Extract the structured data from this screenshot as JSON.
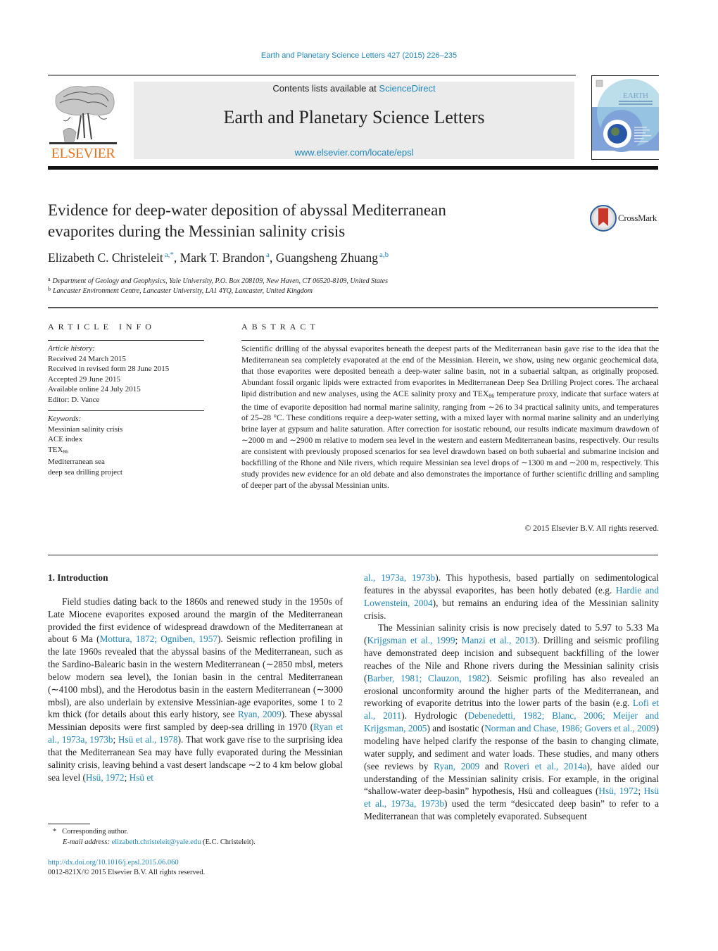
{
  "header": {
    "citation": "Earth and Planetary Science Letters 427 (2015) 226–235",
    "contents_prefix": "Contents lists available at ",
    "contents_link": "ScienceDirect",
    "journal_title": "Earth and Planetary Science Letters",
    "journal_url": "www.elsevier.com/locate/epsl",
    "publisher_logo_text": "ELSEVIER",
    "cover_title": "EARTH",
    "cover_subtitle": "& PLANETARY SCIENCE LETTERS"
  },
  "article": {
    "title_line1": "Evidence for deep-water deposition of abyssal Mediterranean",
    "title_line2": "evaporites during the Messinian salinity crisis",
    "crossmark_label": "CrossMark",
    "authors": [
      {
        "name": "Elizabeth C. Christeleit",
        "sup": "a,*",
        "sep": ", "
      },
      {
        "name": "Mark T. Brandon",
        "sup": "a",
        "sep": ", "
      },
      {
        "name": "Guangsheng Zhuang",
        "sup": "a,b",
        "sep": ""
      }
    ],
    "affiliations": [
      {
        "key": "a",
        "text": "Department of Geology and Geophysics, Yale University, P.O. Box 208109, New Haven, CT 06520-8109, United States"
      },
      {
        "key": "b",
        "text": "Lancaster Environment Centre, Lancaster University, LA1 4YQ, Lancaster, United Kingdom"
      }
    ]
  },
  "article_info": {
    "heading": "ARTICLE INFO",
    "history_label": "Article history:",
    "history": [
      "Received 24 March 2015",
      "Received in revised form 28 June 2015",
      "Accepted 29 June 2015",
      "Available online 24 July 2015",
      "Editor: D. Vance"
    ],
    "keywords_label": "Keywords:",
    "keywords": [
      {
        "text": "Messinian salinity crisis",
        "sub": ""
      },
      {
        "text": "ACE index",
        "sub": ""
      },
      {
        "text": "TEX",
        "sub": "86"
      },
      {
        "text": "Mediterranean sea",
        "sub": ""
      },
      {
        "text": "deep sea drilling project",
        "sub": ""
      }
    ]
  },
  "abstract": {
    "heading": "ABSTRACT",
    "text_part1": "Scientific drilling of the abyssal evaporites beneath the deepest parts of the Mediterranean basin gave rise to the idea that the Mediterranean sea completely evaporated at the end of the Messinian. Herein, we show, using new organic geochemical data, that those evaporites were deposited beneath a deep-water saline basin, not in a subaerial saltpan, as originally proposed. Abundant fossil organic lipids were extracted from evaporites in Mediterranean Deep Sea Drilling Project cores. The archaeal lipid distribution and new analyses, using the ACE salinity proxy and TEX",
    "text_sub": "86",
    "text_part2": " temperature proxy, indicate that surface waters at the time of evaporite deposition had normal marine salinity, ranging from ∼26 to 34 practical salinity units, and temperatures of 25–28 °C. These conditions require a deep-water setting, with a mixed layer with normal marine salinity and an underlying brine layer at gypsum and halite saturation. After correction for isostatic rebound, our results indicate maximum drawdown of ∼2000 m and ∼2900 m relative to modern sea level in the western and eastern Mediterranean basins, respectively. Our results are consistent with previously proposed scenarios for sea level drawdown based on both subaerial and submarine incision and backfilling of the Rhone and Nile rivers, which require Messinian sea level drops of ∼1300 m and ∼200 m, respectively. This study provides new evidence for an old debate and also demonstrates the importance of further scientific drilling and sampling of deeper part of the abyssal Messinian units.",
    "copyright": "© 2015 Elsevier B.V. All rights reserved."
  },
  "body": {
    "section_heading": "1. Introduction",
    "left_column": [
      {
        "t": "Field studies dating back to the 1860s and renewed study in the 1950s of Late Miocene evaporites exposed around the margin of the Mediterranean provided the first evidence of widespread drawdown of the Mediterranean at about 6 Ma (",
        "link": false
      },
      {
        "t": "Mottura, 1872; Ogniben, 1957",
        "link": true
      },
      {
        "t": "). Seismic reflection profiling in the late 1960s revealed that the abyssal basins of the Mediterranean, such as the Sardino-Balearic basin in the western Mediterranean (∼2850 mbsl, meters below modern sea level), the Ionian basin in the central Mediterranean (∼4100 mbsl), and the Herodotus basin in the eastern Mediterranean (∼3000 mbsl), are also underlain by extensive Messinian-age evaporites, some 1 to 2 km thick (for details about this early history, see ",
        "link": false
      },
      {
        "t": "Ryan, 2009",
        "link": true
      },
      {
        "t": "). These abyssal Messinian deposits were first sampled by deep-sea drilling in 1970 (",
        "link": false
      },
      {
        "t": "Ryan et al., 1973a, 1973b",
        "link": true
      },
      {
        "t": "; ",
        "link": false
      },
      {
        "t": "Hsü et al., 1978",
        "link": true
      },
      {
        "t": "). That work gave rise to the surprising idea that the Mediterranean Sea may have fully evaporated during the Messinian salinity crisis, leaving behind a vast desert landscape ∼2 to 4 km below global sea level (",
        "link": false
      },
      {
        "t": "Hsü, 1972",
        "link": true
      },
      {
        "t": "; ",
        "link": false
      },
      {
        "t": "Hsü et",
        "link": true
      }
    ],
    "right_column_p1": [
      {
        "t": "al., 1973a, 1973b",
        "link": true
      },
      {
        "t": "). This hypothesis, based partially on sedimentological features in the abyssal evaporites, has been hotly debated (e.g. ",
        "link": false
      },
      {
        "t": "Hardie and Lowenstein, 2004",
        "link": true
      },
      {
        "t": "), but remains an enduring idea of the Messinian salinity crisis.",
        "link": false
      }
    ],
    "right_column_p2": [
      {
        "t": "The Messinian salinity crisis is now precisely dated to 5.97 to 5.33 Ma (",
        "link": false
      },
      {
        "t": "Krijgsman et al., 1999",
        "link": true
      },
      {
        "t": "; ",
        "link": false
      },
      {
        "t": "Manzi et al., 2013",
        "link": true
      },
      {
        "t": "). Drilling and seismic profiling have demonstrated deep incision and subsequent backfilling of the lower reaches of the Nile and Rhone rivers during the Messinian salinity crisis (",
        "link": false
      },
      {
        "t": "Barber, 1981; Clauzon, 1982",
        "link": true
      },
      {
        "t": "). Seismic profiling has also revealed an erosional unconformity around the higher parts of the Mediterranean, and reworking of evaporite detritus into the lower parts of the basin (e.g. ",
        "link": false
      },
      {
        "t": "Lofi et al., 2011",
        "link": true
      },
      {
        "t": "). Hydrologic (",
        "link": false
      },
      {
        "t": "Debenedetti, 1982; Blanc, 2006; Meijer and Krijgsman, 2005",
        "link": true
      },
      {
        "t": ") and isostatic (",
        "link": false
      },
      {
        "t": "Norman and Chase, 1986; Govers et al., 2009",
        "link": true
      },
      {
        "t": ") modeling have helped clarify the response of the basin to changing climate, water supply, and sediment and water loads. These studies, and many others (see reviews by ",
        "link": false
      },
      {
        "t": "Ryan, 2009",
        "link": true
      },
      {
        "t": " and ",
        "link": false
      },
      {
        "t": "Roveri et al., 2014a",
        "link": true
      },
      {
        "t": "), have aided our understanding of the Messinian salinity crisis. For example, in the original “shallow-water deep-basin” hypothesis, Hsü and colleagues (",
        "link": false
      },
      {
        "t": "Hsü, 1972",
        "link": true
      },
      {
        "t": "; ",
        "link": false
      },
      {
        "t": "Hsü et al., 1973a, 1973b",
        "link": true
      },
      {
        "t": ") used the term “desiccated deep basin” to refer to a Mediterranean that was completely evaporated. Subsequent",
        "link": false
      }
    ]
  },
  "footnotes": {
    "marker": "*",
    "corresponding": "Corresponding author.",
    "email_label": "E-mail address:",
    "email": "elizabeth.christeleit@yale.edu",
    "email_suffix": " (E.C. Christeleit).",
    "doi": "http://dx.doi.org/10.1016/j.epsl.2015.06.060",
    "issn_rights": "0012-821X/© 2015 Elsevier B.V. All rights reserved."
  },
  "colors": {
    "link": "#1f86b8",
    "elsevier_orange": "#e9711c",
    "banner_gray": "#ebebeb"
  }
}
